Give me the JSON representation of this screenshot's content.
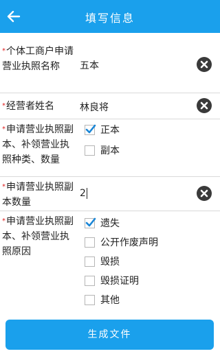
{
  "header": {
    "title": "填写信息",
    "back_icon": "arrow-left-icon"
  },
  "fields": {
    "business_name": {
      "label": "个体工商户申请营业执照名称",
      "value": "五本"
    },
    "operator_name": {
      "label": "经营者姓名",
      "value": "林良将"
    },
    "license_type": {
      "label": "申请营业执照副本、补领营业执照种类、数量",
      "options": [
        {
          "label": "正本",
          "checked": true
        },
        {
          "label": "副本",
          "checked": false
        }
      ]
    },
    "copy_count": {
      "label": "申请营业执照副本数量",
      "value": "2"
    },
    "reason": {
      "label": "申请营业执照副本、补领营业执照原因",
      "options": [
        {
          "label": "遗失",
          "checked": true
        },
        {
          "label": "公开作废声明",
          "checked": false
        },
        {
          "label": "毁损",
          "checked": false
        },
        {
          "label": "毁损证明",
          "checked": false
        },
        {
          "label": "其他",
          "checked": false
        }
      ]
    }
  },
  "footer": {
    "generate_label": "生成文件"
  },
  "colors": {
    "accent": "#1aa0ec",
    "required": "#e02020"
  }
}
